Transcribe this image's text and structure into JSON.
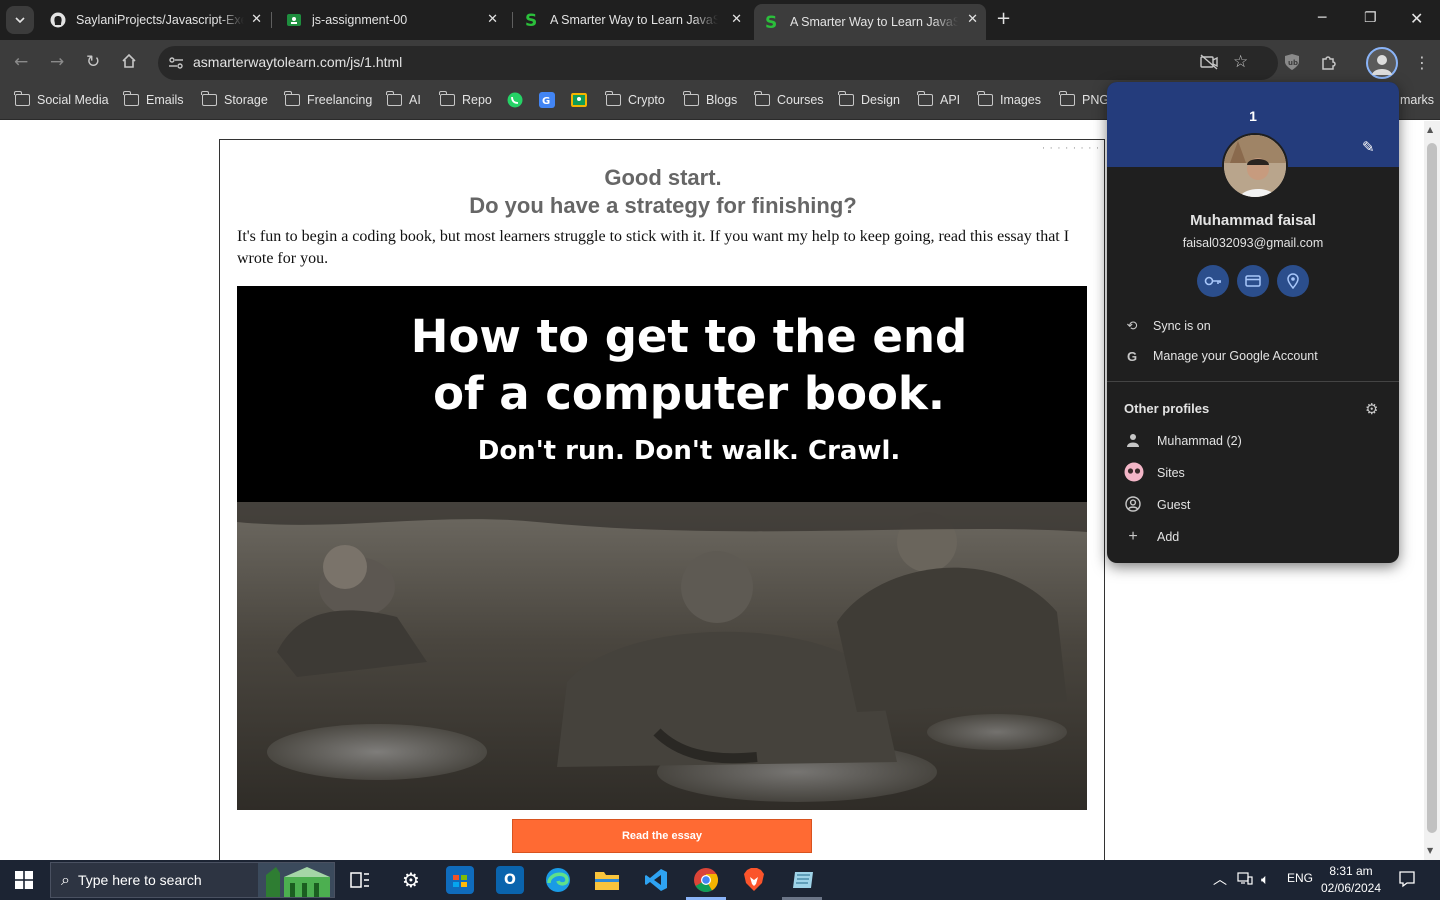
{
  "tabs": [
    {
      "title": "SaylaniProjects/Javascript-Exercises",
      "icon": "github-icon"
    },
    {
      "title": "js-assignment-00",
      "icon": "classroom-icon"
    },
    {
      "title": "A Smarter Way to Learn JavaScript",
      "icon": "smarter-way-icon"
    },
    {
      "title": "A Smarter Way to Learn JavaScript",
      "icon": "smarter-way-icon",
      "active": true
    }
  ],
  "address": {
    "url": "asmarterwaytolearn.com/js/1.html"
  },
  "bookmarks": [
    {
      "label": "Social Media"
    },
    {
      "label": "Emails"
    },
    {
      "label": "Storage"
    },
    {
      "label": "Freelancing"
    },
    {
      "label": "AI"
    },
    {
      "label": "Repo"
    },
    {
      "label": "Crypto"
    },
    {
      "label": "Blogs"
    },
    {
      "label": "Courses"
    },
    {
      "label": "Design"
    },
    {
      "label": "API"
    },
    {
      "label": "Images"
    },
    {
      "label": "PNG"
    }
  ],
  "bookmarks_overflow": "marks",
  "page": {
    "heading1": "Good start.",
    "heading2": "Do you have a strategy for finishing?",
    "intro": "It's fun to begin a coding book, but most learners struggle to stick with it. If you want my help to keep going, read this essay that I wrote for you.",
    "hero_line1": "How to get to the end",
    "hero_line2": "of a computer book.",
    "hero_sub": "Don't run. Don't walk. Crawl.",
    "button": "Read the essay"
  },
  "profile": {
    "number": "1",
    "name": "Muhammad faisal",
    "email": "faisal032093@gmail.com",
    "sync": "Sync is on",
    "manage": "Manage your Google Account",
    "other_heading": "Other profiles",
    "others": [
      {
        "label": "Muhammad (2)",
        "icon": "person-icon"
      },
      {
        "label": "Sites",
        "icon": "sites-avatar-icon"
      },
      {
        "label": "Guest",
        "icon": "guest-icon"
      },
      {
        "label": "Add",
        "icon": "plus-icon"
      }
    ]
  },
  "taskbar": {
    "search_placeholder": "Type here to search",
    "language": "ENG",
    "time": "8:31 am",
    "date": "02/06/2024"
  },
  "colors": {
    "accent_button": "#ff6a33",
    "profile_banner": "#243c7c",
    "chrome_dark": "#3c3c3c"
  }
}
